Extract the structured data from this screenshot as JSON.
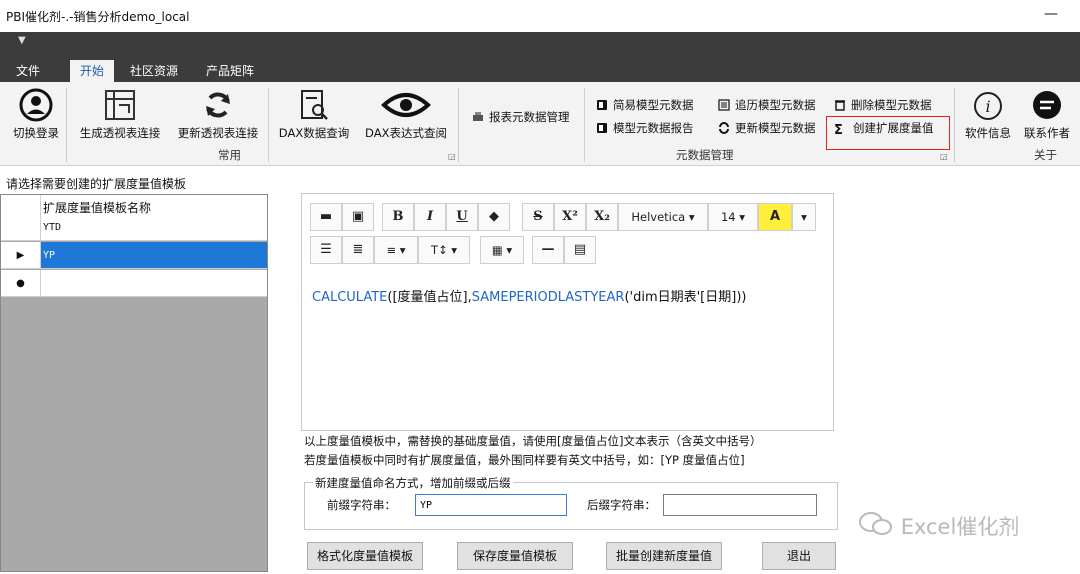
{
  "window": {
    "title": "PBI催化剂-.-销售分析demo_local",
    "min_label": "—"
  },
  "tabs": [
    {
      "label": "文件"
    },
    {
      "label": "开始"
    },
    {
      "label": "社区资源"
    },
    {
      "label": "产品矩阵"
    }
  ],
  "ribbon": {
    "login": "切换登录",
    "gen_pivot": "生成透视表连接",
    "refresh_pivot": "更新透视表连接",
    "dax_query": "DAX数据查询",
    "dax_viewer": "DAX表达式查阅",
    "group_common": "常用",
    "report_meta": "报表元数据管理",
    "simple_model": "简易模型元数据",
    "model_report": "模型元数据报告",
    "history_model": "追历模型元数据",
    "update_model": "更新模型元数据",
    "delete_model": "删除模型元数据",
    "create_ext": "创建扩展度量值",
    "group_meta": "元数据管理",
    "software_info": "软件信息",
    "contact": "联系作者",
    "group_about": "关于"
  },
  "left_panel": {
    "header": "请选择需要创建的扩展度量值模板",
    "column_header": "扩展度量值模板名称",
    "rows": [
      {
        "marker": "",
        "name": "YTD"
      },
      {
        "marker": "▶",
        "name": "YP"
      },
      {
        "marker": "●",
        "name": ""
      }
    ]
  },
  "editor": {
    "font_name": "Helvetica",
    "font_size": "14",
    "code_kw1": "CALCULATE",
    "code_arg1": "([度量值占位],",
    "code_kw2": "SAMEPERIODLASTYEAR",
    "code_arg2": "('dim日期表'[日期]))"
  },
  "notes": {
    "line1": "以上度量值模板中，需替换的基础度量值，请使用[度量值占位]文本表示（含英文中括号）",
    "line2": "若度量值模板中同时有扩展度量值，最外围同样要有英文中括号，如：[YP 度量值占位]"
  },
  "naming": {
    "legend": "新建度量值命名方式，增加前缀或后缀",
    "prefix_label": "前缀字符串：",
    "prefix_value": "YP",
    "suffix_label": "后缀字符串：",
    "suffix_value": ""
  },
  "buttons": {
    "format": "格式化度量值模板",
    "save": "保存度量值模板",
    "batch": "批量创建新度量值",
    "exit": "退出"
  },
  "watermark": "Excel催化剂"
}
